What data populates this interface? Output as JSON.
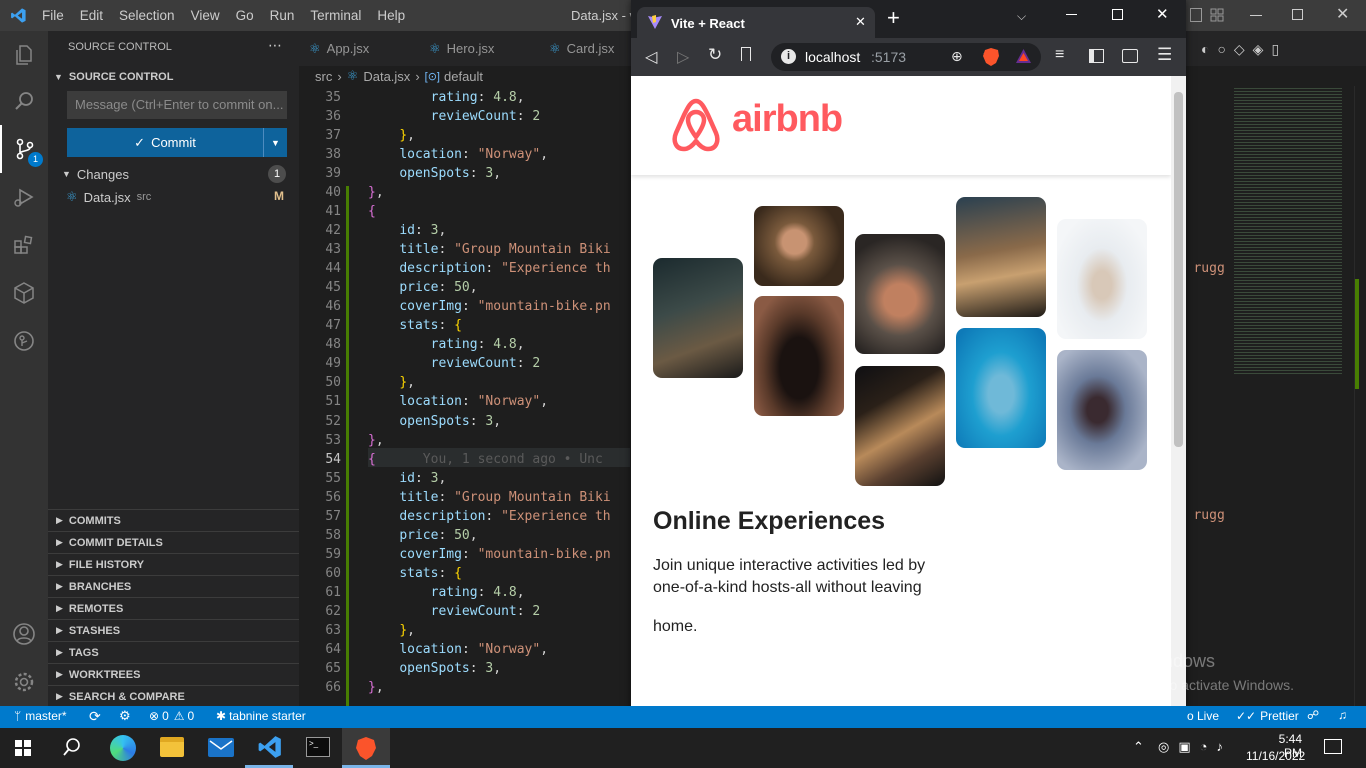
{
  "vscode": {
    "menu": [
      "File",
      "Edit",
      "Selection",
      "View",
      "Go",
      "Run",
      "Terminal",
      "Help"
    ],
    "window_title": "Data.jsx - v",
    "sidebar": {
      "header": "SOURCE CONTROL",
      "section_title": "SOURCE CONTROL",
      "message_placeholder": "Message (Ctrl+Enter to commit on...",
      "commit_label": "Commit",
      "changes_label": "Changes",
      "changes_count": "1",
      "file_name": "Data.jsx",
      "file_dir": "src",
      "file_status": "M",
      "scm_badge": "1",
      "sections": [
        "COMMITS",
        "COMMIT DETAILS",
        "FILE HISTORY",
        "BRANCHES",
        "REMOTES",
        "STASHES",
        "TAGS",
        "WORKTREES",
        "SEARCH & COMPARE"
      ]
    },
    "tabs": [
      "App.jsx",
      "Hero.jsx",
      "Card.jsx"
    ],
    "breadcrumb": {
      "folder": "src",
      "file": "Data.jsx",
      "symbol": "default"
    },
    "lines": [
      {
        "n": "35",
        "t": [
          [
            "        ",
            "w"
          ],
          [
            "rating",
            "k"
          ],
          [
            ": ",
            "w"
          ],
          [
            "4.8",
            "n"
          ],
          [
            ",",
            "w"
          ]
        ]
      },
      {
        "n": "36",
        "t": [
          [
            "        ",
            "w"
          ],
          [
            "reviewCount",
            "k"
          ],
          [
            ": ",
            "w"
          ],
          [
            "2",
            "n"
          ]
        ]
      },
      {
        "n": "37",
        "t": [
          [
            "    ",
            "w"
          ],
          [
            "}",
            "p"
          ],
          [
            ",",
            "w"
          ]
        ]
      },
      {
        "n": "38",
        "t": [
          [
            "    ",
            "w"
          ],
          [
            "location",
            "k"
          ],
          [
            ": ",
            "w"
          ],
          [
            "\"Norway\"",
            "s"
          ],
          [
            ",",
            "w"
          ]
        ]
      },
      {
        "n": "39",
        "t": [
          [
            "    ",
            "w"
          ],
          [
            "openSpots",
            "k"
          ],
          [
            ": ",
            "w"
          ],
          [
            "3",
            "n"
          ],
          [
            ",",
            "w"
          ]
        ]
      },
      {
        "n": "40",
        "t": [
          [
            "}",
            "p"
          ],
          [
            ",",
            "w"
          ]
        ]
      },
      {
        "n": "41",
        "t": [
          [
            "{",
            "p"
          ]
        ]
      },
      {
        "n": "42",
        "t": [
          [
            "    ",
            "w"
          ],
          [
            "id",
            "k"
          ],
          [
            ": ",
            "w"
          ],
          [
            "3",
            "n"
          ],
          [
            ",",
            "w"
          ]
        ]
      },
      {
        "n": "43",
        "t": [
          [
            "    ",
            "w"
          ],
          [
            "title",
            "k"
          ],
          [
            ": ",
            "w"
          ],
          [
            "\"Group Mountain Biki",
            "s"
          ]
        ]
      },
      {
        "n": "44",
        "t": [
          [
            "    ",
            "w"
          ],
          [
            "description",
            "k"
          ],
          [
            ": ",
            "w"
          ],
          [
            "\"Experience th",
            "s"
          ]
        ]
      },
      {
        "n": "45",
        "t": [
          [
            "    ",
            "w"
          ],
          [
            "price",
            "k"
          ],
          [
            ": ",
            "w"
          ],
          [
            "50",
            "n"
          ],
          [
            ",",
            "w"
          ]
        ]
      },
      {
        "n": "46",
        "t": [
          [
            "    ",
            "w"
          ],
          [
            "coverImg",
            "k"
          ],
          [
            ": ",
            "w"
          ],
          [
            "\"mountain-bike.pn",
            "s"
          ]
        ]
      },
      {
        "n": "47",
        "t": [
          [
            "    ",
            "w"
          ],
          [
            "stats",
            "k"
          ],
          [
            ": ",
            "w"
          ],
          [
            "{",
            "p"
          ]
        ]
      },
      {
        "n": "48",
        "t": [
          [
            "        ",
            "w"
          ],
          [
            "rating",
            "k"
          ],
          [
            ": ",
            "w"
          ],
          [
            "4.8",
            "n"
          ],
          [
            ",",
            "w"
          ]
        ]
      },
      {
        "n": "49",
        "t": [
          [
            "        ",
            "w"
          ],
          [
            "reviewCount",
            "k"
          ],
          [
            ": ",
            "w"
          ],
          [
            "2",
            "n"
          ]
        ]
      },
      {
        "n": "50",
        "t": [
          [
            "    ",
            "w"
          ],
          [
            "}",
            "p"
          ],
          [
            ",",
            "w"
          ]
        ]
      },
      {
        "n": "51",
        "t": [
          [
            "    ",
            "w"
          ],
          [
            "location",
            "k"
          ],
          [
            ": ",
            "w"
          ],
          [
            "\"Norway\"",
            "s"
          ],
          [
            ",",
            "w"
          ]
        ]
      },
      {
        "n": "52",
        "t": [
          [
            "    ",
            "w"
          ],
          [
            "openSpots",
            "k"
          ],
          [
            ": ",
            "w"
          ],
          [
            "3",
            "n"
          ],
          [
            ",",
            "w"
          ]
        ]
      },
      {
        "n": "53",
        "t": [
          [
            "}",
            "p"
          ],
          [
            ",",
            "w"
          ]
        ]
      },
      {
        "n": "54",
        "t": [
          [
            "{",
            "p"
          ],
          [
            "      You, 1 second ago • Unc",
            "blame"
          ]
        ]
      },
      {
        "n": "55",
        "t": [
          [
            "    ",
            "w"
          ],
          [
            "id",
            "k"
          ],
          [
            ": ",
            "w"
          ],
          [
            "3",
            "n"
          ],
          [
            ",",
            "w"
          ]
        ]
      },
      {
        "n": "56",
        "t": [
          [
            "    ",
            "w"
          ],
          [
            "title",
            "k"
          ],
          [
            ": ",
            "w"
          ],
          [
            "\"Group Mountain Biki",
            "s"
          ]
        ]
      },
      {
        "n": "57",
        "t": [
          [
            "    ",
            "w"
          ],
          [
            "description",
            "k"
          ],
          [
            ": ",
            "w"
          ],
          [
            "\"Experience th",
            "s"
          ]
        ]
      },
      {
        "n": "58",
        "t": [
          [
            "    ",
            "w"
          ],
          [
            "price",
            "k"
          ],
          [
            ": ",
            "w"
          ],
          [
            "50",
            "n"
          ],
          [
            ",",
            "w"
          ]
        ]
      },
      {
        "n": "59",
        "t": [
          [
            "    ",
            "w"
          ],
          [
            "coverImg",
            "k"
          ],
          [
            ": ",
            "w"
          ],
          [
            "\"mountain-bike.pn",
            "s"
          ]
        ]
      },
      {
        "n": "60",
        "t": [
          [
            "    ",
            "w"
          ],
          [
            "stats",
            "k"
          ],
          [
            ": ",
            "w"
          ],
          [
            "{",
            "p"
          ]
        ]
      },
      {
        "n": "61",
        "t": [
          [
            "        ",
            "w"
          ],
          [
            "rating",
            "k"
          ],
          [
            ": ",
            "w"
          ],
          [
            "4.8",
            "n"
          ],
          [
            ",",
            "w"
          ]
        ]
      },
      {
        "n": "62",
        "t": [
          [
            "        ",
            "w"
          ],
          [
            "reviewCount",
            "k"
          ],
          [
            ": ",
            "w"
          ],
          [
            "2",
            "n"
          ]
        ]
      },
      {
        "n": "63",
        "t": [
          [
            "    ",
            "w"
          ],
          [
            "}",
            "p"
          ],
          [
            ",",
            "w"
          ]
        ]
      },
      {
        "n": "64",
        "t": [
          [
            "    ",
            "w"
          ],
          [
            "location",
            "k"
          ],
          [
            ": ",
            "w"
          ],
          [
            "\"Norway\"",
            "s"
          ],
          [
            ",",
            "w"
          ]
        ]
      },
      {
        "n": "65",
        "t": [
          [
            "    ",
            "w"
          ],
          [
            "openSpots",
            "k"
          ],
          [
            ": ",
            "w"
          ],
          [
            "3",
            "n"
          ],
          [
            ",",
            "w"
          ]
        ]
      },
      {
        "n": "66",
        "t": [
          [
            "}",
            "p"
          ],
          [
            ",",
            "w"
          ]
        ]
      }
    ],
    "overflow_text": "ng rugg",
    "status": {
      "branch": "master*",
      "errors": "0",
      "warnings": "0",
      "tabnine": "tabnine starter",
      "golive": "o Live",
      "prettier": "Prettier"
    }
  },
  "browser": {
    "tab_title": "Vite + React",
    "url_host": "localhost",
    "url_port": ":5173",
    "logo_text": "airbnb",
    "hero_title": "Online Experiences",
    "hero_text_1": "Join unique interactive activities led by",
    "hero_text_2": "one-of-a-kind hosts-all without leaving",
    "hero_text_3": "home."
  },
  "activate": {
    "title": "Activate Windows",
    "sub": "Go to Settings to activate Windows."
  },
  "taskbar": {
    "time": "5:44 PM",
    "date": "11/16/2022"
  },
  "colors": {
    "airbnb": "#ff5a5f",
    "vscode_blue": "#007acc",
    "commit_btn": "#0e639c"
  }
}
